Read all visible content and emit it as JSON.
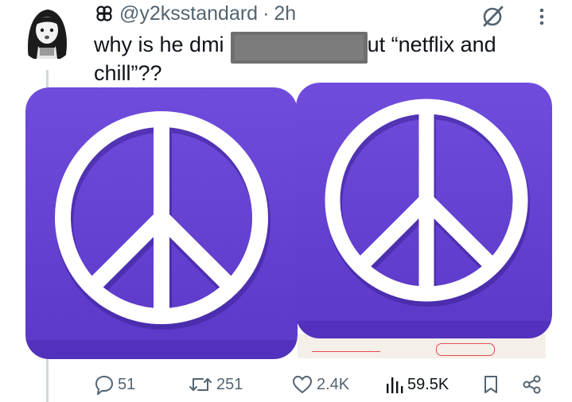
{
  "tweet": {
    "handle": "@y2ksstandard",
    "separator": "·",
    "time": "2h",
    "text_line1_start": "why is he dmi",
    "text_line1_end": "ut “netflix and",
    "text_line2": "chill”??"
  },
  "image_stamp_text": "",
  "actions": {
    "replies": "51",
    "reposts": "251",
    "likes": "2.4K",
    "views": "59.5K"
  },
  "colors": {
    "icon_purple": "#6c4ad8",
    "icon_purple_dark": "#5534c2",
    "muted_text": "#536471",
    "thread_line": "#cfd9de"
  },
  "icons": [
    "avatar-image",
    "badge-icon",
    "grok-icon",
    "more-icon",
    "reply-icon",
    "repost-icon",
    "like-icon",
    "views-icon",
    "bookmark-icon",
    "share-icon",
    "peace-sign-icon"
  ]
}
